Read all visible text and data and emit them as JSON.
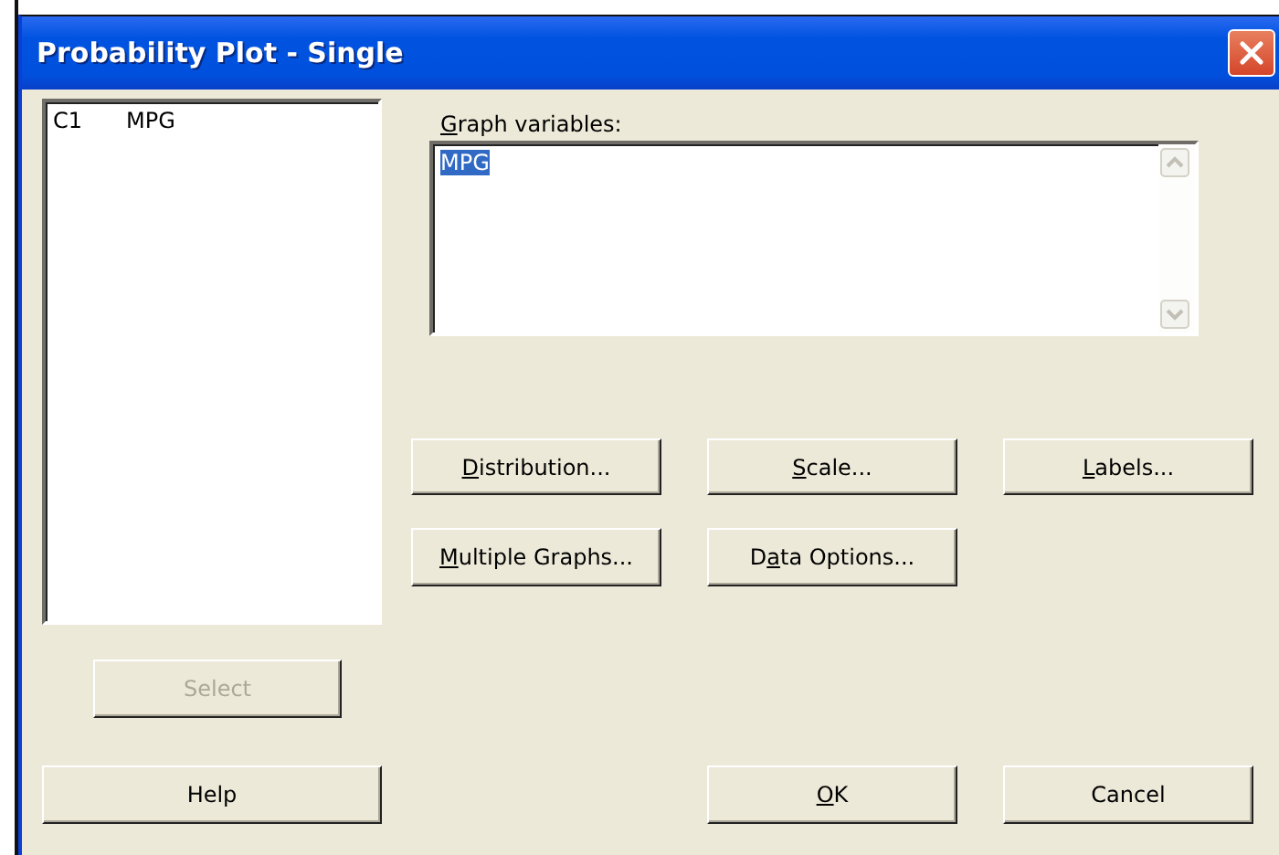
{
  "window": {
    "title": "Probability Plot - Single"
  },
  "variable_list": [
    {
      "column": "C1",
      "name": "MPG"
    }
  ],
  "graph_variables": {
    "label": [
      {
        "text": "G",
        "underline": true
      },
      {
        "text": "raph variables:",
        "underline": false
      }
    ],
    "value": "MPG",
    "selected": true
  },
  "option_buttons": [
    [
      {
        "parts": [
          {
            "text": "D",
            "underline": true
          },
          {
            "text": "istribution...",
            "underline": false
          }
        ]
      },
      {
        "parts": [
          {
            "text": "S",
            "underline": true
          },
          {
            "text": "cale...",
            "underline": false
          }
        ]
      },
      {
        "parts": [
          {
            "text": "L",
            "underline": true
          },
          {
            "text": "abels...",
            "underline": false
          }
        ]
      }
    ],
    [
      {
        "parts": [
          {
            "text": "M",
            "underline": true
          },
          {
            "text": "ultiple Graphs...",
            "underline": false
          }
        ]
      },
      {
        "parts": [
          {
            "text": "D",
            "underline": false
          },
          {
            "text": "a",
            "underline": true
          },
          {
            "text": "ta Options...",
            "underline": false
          }
        ]
      }
    ]
  ],
  "select_button": {
    "label": "Select",
    "disabled": true
  },
  "dialog_buttons": [
    {
      "parts": [
        {
          "text": "Help",
          "underline": false
        }
      ]
    },
    {
      "parts": [
        {
          "text": "O",
          "underline": true
        },
        {
          "text": "K",
          "underline": false
        }
      ]
    },
    {
      "parts": [
        {
          "text": "Cancel",
          "underline": false
        }
      ]
    }
  ]
}
